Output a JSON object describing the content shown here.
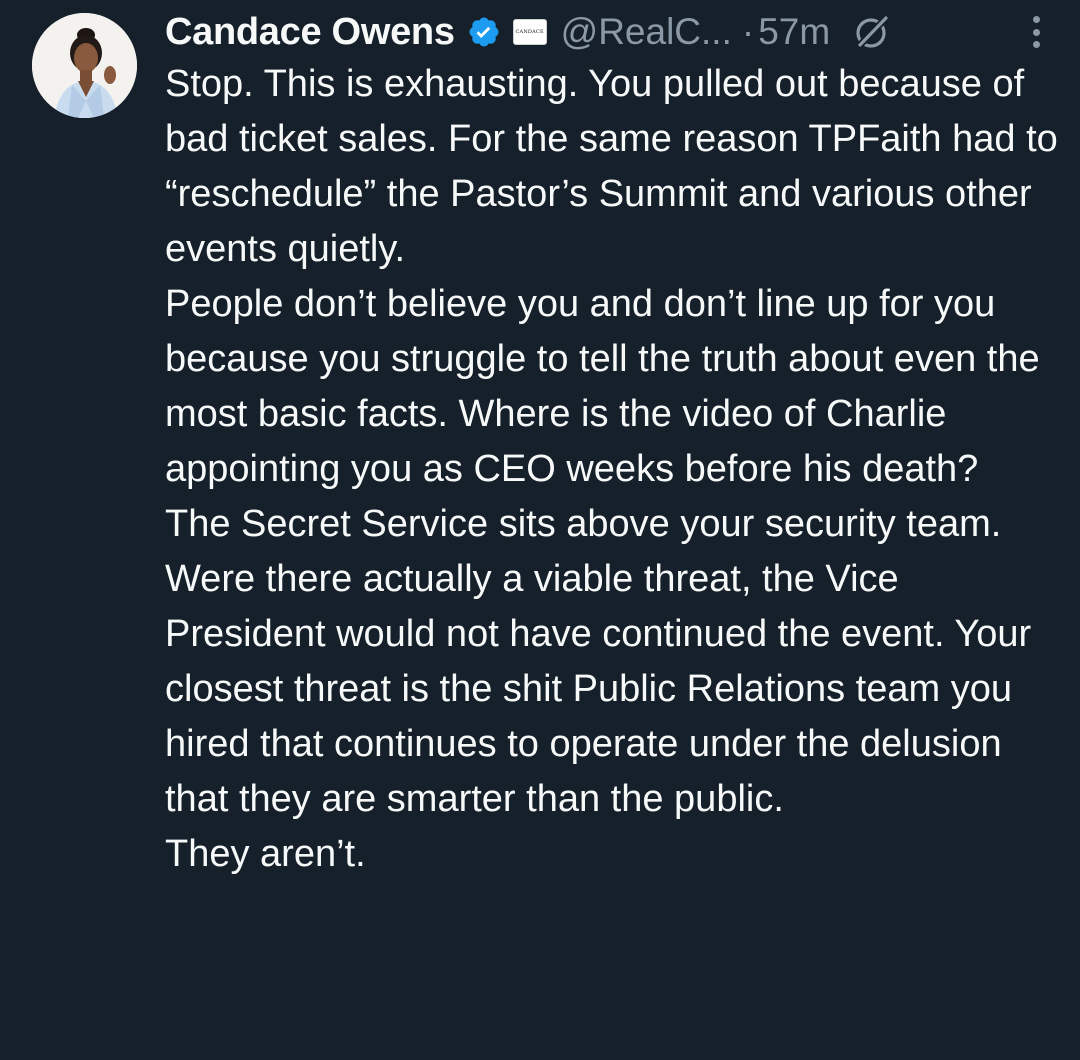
{
  "tweet": {
    "display_name": "Candace Owens",
    "affiliate_badge_text": "CANDACE",
    "handle": "@RealC...",
    "separator": "·",
    "time": "57m",
    "paragraphs": [
      "Stop. This is exhausting. You pulled out because of bad ticket sales. For the same reason TPFaith had to “reschedule” the Pastor’s Summit and various other events quietly.",
      "People don’t believe you and don’t line up for you because you struggle to tell the truth about even the most basic facts. Where is the video of Charlie appointing you as CEO weeks before his death?",
      "The Secret Service sits above your security team. Were there actually a viable threat, the Vice President would not have continued the event. Your closest threat is the shit Public Relations team you hired that continues to operate under the delusion that they are smarter than the public.",
      "They aren’t."
    ]
  },
  "icons": {
    "verified": "verified-badge-icon",
    "grok": "grok-icon",
    "more": "more-options-icon",
    "avatar": "profile-avatar"
  },
  "colors": {
    "background": "#15202b",
    "text_primary": "#f7f9f9",
    "text_secondary": "#8b98a5",
    "verified_blue": "#1d9bf0"
  }
}
